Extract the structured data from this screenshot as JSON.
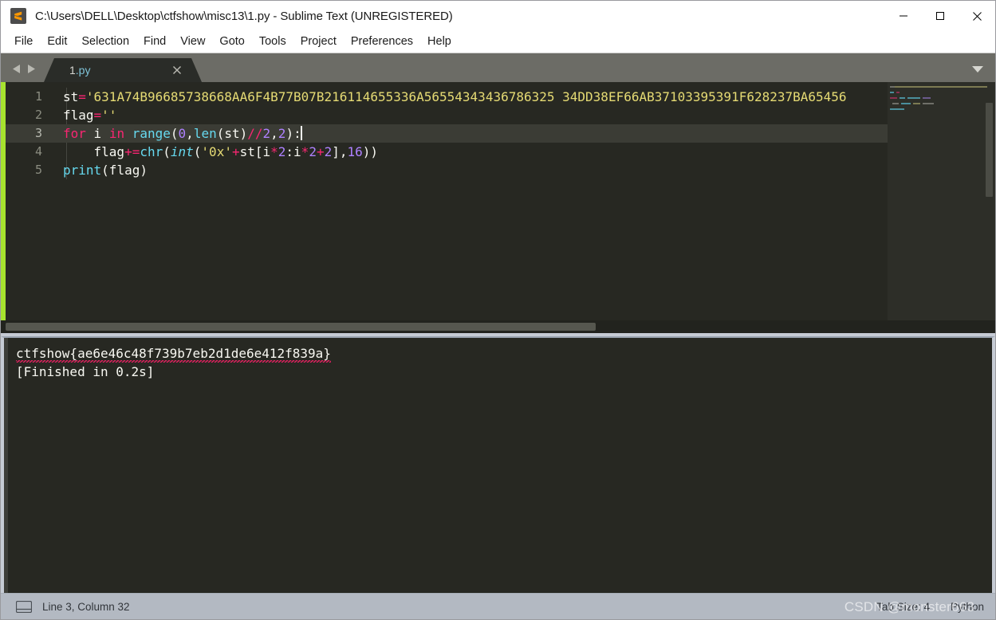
{
  "window": {
    "title": "C:\\Users\\DELL\\Desktop\\ctfshow\\misc13\\1.py - Sublime Text (UNREGISTERED)",
    "app_icon": "sublime-text-icon",
    "minimize_label": "Minimize",
    "maximize_label": "Maximize",
    "close_label": "Close"
  },
  "menubar": {
    "items": [
      {
        "label": "File"
      },
      {
        "label": "Edit"
      },
      {
        "label": "Selection"
      },
      {
        "label": "Find"
      },
      {
        "label": "View"
      },
      {
        "label": "Goto"
      },
      {
        "label": "Tools"
      },
      {
        "label": "Project"
      },
      {
        "label": "Preferences"
      },
      {
        "label": "Help"
      }
    ]
  },
  "tabbar": {
    "prev_icon": "triangle-left-icon",
    "next_icon": "triangle-right-icon",
    "tabs": [
      {
        "name": "1",
        "ext": ".py",
        "close_icon": "close-icon",
        "active": true
      }
    ],
    "overflow_icon": "chevron-down-icon"
  },
  "editor": {
    "language": "Python",
    "gutter": [
      "1",
      "2",
      "3",
      "4",
      "5"
    ],
    "active_line": 3,
    "lines": [
      {
        "n": 1,
        "tokens": [
          {
            "t": "st",
            "c": "tok-var"
          },
          {
            "t": "=",
            "c": "tok-op"
          },
          {
            "t": "'631A74B96685738668AA6F4B77B07B216114655336A56554343436786325 34DD38EF66AB37103395391F628237BA65456",
            "c": "tok-str"
          }
        ]
      },
      {
        "n": 2,
        "tokens": [
          {
            "t": "flag",
            "c": "tok-var"
          },
          {
            "t": "=",
            "c": "tok-op"
          },
          {
            "t": "''",
            "c": "tok-str"
          }
        ]
      },
      {
        "n": 3,
        "tokens": [
          {
            "t": "for",
            "c": "tok-kw"
          },
          {
            "t": " i ",
            "c": "tok-var"
          },
          {
            "t": "in",
            "c": "tok-kw"
          },
          {
            "t": " ",
            "c": "tok-var"
          },
          {
            "t": "range",
            "c": "tok-fn"
          },
          {
            "t": "(",
            "c": "tok-punct"
          },
          {
            "t": "0",
            "c": "tok-num"
          },
          {
            "t": ",",
            "c": "tok-punct"
          },
          {
            "t": "len",
            "c": "tok-fn"
          },
          {
            "t": "(st)",
            "c": "tok-punct"
          },
          {
            "t": "//",
            "c": "tok-op"
          },
          {
            "t": "2",
            "c": "tok-num"
          },
          {
            "t": ",",
            "c": "tok-punct"
          },
          {
            "t": "2",
            "c": "tok-num"
          },
          {
            "t": "):",
            "c": "tok-punct"
          }
        ]
      },
      {
        "n": 4,
        "tokens": [
          {
            "t": "    flag",
            "c": "tok-var"
          },
          {
            "t": "+=",
            "c": "tok-op"
          },
          {
            "t": "chr",
            "c": "tok-fn"
          },
          {
            "t": "(",
            "c": "tok-punct"
          },
          {
            "t": "int",
            "c": "tok-builtin"
          },
          {
            "t": "(",
            "c": "tok-punct"
          },
          {
            "t": "'0x'",
            "c": "tok-str"
          },
          {
            "t": "+",
            "c": "tok-op"
          },
          {
            "t": "st[i",
            "c": "tok-punct"
          },
          {
            "t": "*",
            "c": "tok-op"
          },
          {
            "t": "2",
            "c": "tok-num"
          },
          {
            "t": ":i",
            "c": "tok-punct"
          },
          {
            "t": "*",
            "c": "tok-op"
          },
          {
            "t": "2",
            "c": "tok-num"
          },
          {
            "t": "+",
            "c": "tok-op"
          },
          {
            "t": "2",
            "c": "tok-num"
          },
          {
            "t": "],",
            "c": "tok-punct"
          },
          {
            "t": "16",
            "c": "tok-num"
          },
          {
            "t": "))",
            "c": "tok-punct"
          }
        ]
      },
      {
        "n": 5,
        "tokens": [
          {
            "t": "print",
            "c": "tok-fn"
          },
          {
            "t": "(flag)",
            "c": "tok-punct"
          }
        ]
      }
    ]
  },
  "output": {
    "lines": [
      {
        "text": "ctfshow{ae6e46c48f739b7eb2d1de6e412f839a}",
        "misspelled": true
      },
      {
        "text": "[Finished in 0.2s]",
        "misspelled": false
      }
    ]
  },
  "statusbar": {
    "layout_icon": "panel-layout-icon",
    "cursor_position": "Line 3, Column 32",
    "tab_size": "Tab Size: 4",
    "syntax": "Python"
  },
  "watermark": {
    "text": "CSDN @monster663"
  },
  "colors": {
    "editor_bg": "#272822",
    "accent_green": "#a6e22e",
    "string_yellow": "#e6db74",
    "keyword_pink": "#f92672",
    "function_cyan": "#66d9ef",
    "number_purple": "#ae81ff",
    "tabbar_bg": "#6c6c66",
    "statusbar_bg": "#b3b9c2"
  }
}
